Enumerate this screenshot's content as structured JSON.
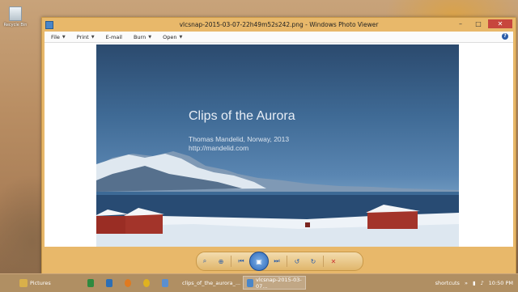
{
  "desktop": {
    "recycle_bin_label": "Recycle Bin"
  },
  "window": {
    "title": "vlcsnap-2015-03-07-22h49m52s242.png - Windows Photo Viewer",
    "buttons": {
      "minimize": "–",
      "maximize": "□",
      "close": "✕"
    }
  },
  "menu": {
    "items": [
      {
        "label": "File"
      },
      {
        "label": "Print"
      },
      {
        "label": "E-mail"
      },
      {
        "label": "Burn"
      },
      {
        "label": "Open"
      }
    ],
    "help": "?"
  },
  "photo": {
    "title": "Clips of the Aurora",
    "subtitle_line1": "Thomas Mandelid, Norway, 2013",
    "subtitle_line2": "http://mandelid.com"
  },
  "controls": {
    "zoom": "⌕",
    "fit": "⊕",
    "previous": "⏮",
    "slideshow": "▣",
    "next": "⏭",
    "rotate_ccw": "↺",
    "rotate_cw": "↻",
    "delete": "✕"
  },
  "taskbar": {
    "items": [
      {
        "label": "Pictures"
      },
      {
        "label": "clips_of_the_aurora_..."
      },
      {
        "label": "vlcsnap-2015-03-07..."
      }
    ],
    "tray": {
      "shortcuts": "shortcuts",
      "time": "10:50 PM"
    }
  },
  "colors": {
    "accent": "#e8b86a",
    "taskbar": "#b08f63",
    "close": "#c7463d"
  }
}
